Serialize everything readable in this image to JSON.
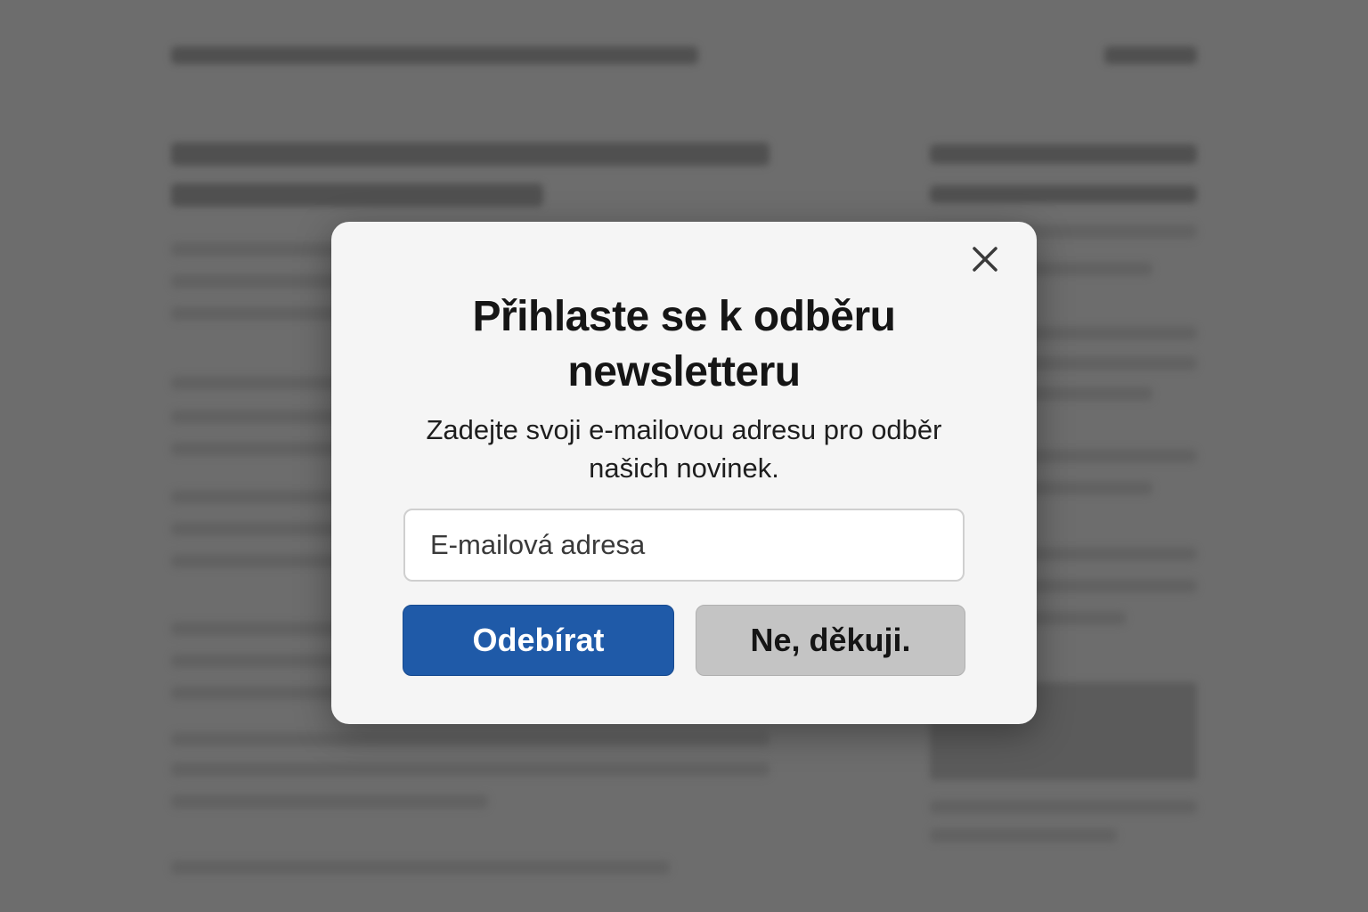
{
  "overlay": {
    "background_color": "#6d6d6d"
  },
  "modal": {
    "close_icon": "close-icon",
    "title": "Přihlaste se k odběru newsletteru",
    "description": "Zadejte svoji e-mailovou adresu pro odběr našich novinek.",
    "email_placeholder": "E-mailová adresa",
    "email_value": "",
    "subscribe_label": "Odebírat",
    "decline_label": "Ne, děkuji.",
    "colors": {
      "primary": "#1f5aa8",
      "secondary": "#c4c4c4",
      "surface": "#f5f5f5"
    }
  }
}
